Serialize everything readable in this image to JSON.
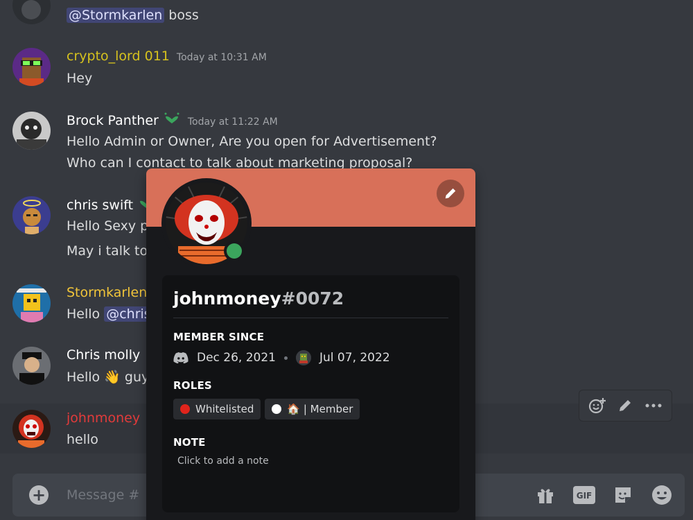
{
  "messages": [
    {
      "id": "m0",
      "username": "",
      "timestamp": "",
      "lines": [
        {
          "mention": "@Stormkarlen",
          "text": " boss"
        }
      ]
    },
    {
      "id": "m1",
      "username": "crypto_lord 011",
      "color": "#d6c21e",
      "timestamp": "Today at 10:31 AM",
      "lines": [
        "Hey"
      ]
    },
    {
      "id": "m2",
      "username": "Brock Panther",
      "color": "#ffffff",
      "timestamp": "Today at 11:22 AM",
      "lines": [
        "Hello Admin or Owner, Are you open for Advertisement?",
        "Who can I contact to talk about marketing proposal?"
      ]
    },
    {
      "id": "m3",
      "username": "chris swift",
      "color": "#ffffff",
      "lines": [
        "Hello Sexy p",
        "May i talk to"
      ]
    },
    {
      "id": "m4",
      "username": "Stormkarlen",
      "color": "#f0c43a",
      "lines": [
        {
          "text": "Hello ",
          "mention": "@chris"
        }
      ]
    },
    {
      "id": "m5",
      "username": "Chris molly",
      "color": "#ffffff",
      "lines": [
        {
          "text": "Hello ",
          "emoji": "👋",
          "tail": " guy"
        }
      ]
    },
    {
      "id": "m6",
      "username": "johnmoney",
      "color": "#e23b3b",
      "lines": [
        "hello"
      ]
    }
  ],
  "composer": {
    "placeholder": "Message #"
  },
  "profile": {
    "username": "johnmoney",
    "discriminator": "#0072",
    "banner_color": "#d87059",
    "status": "online",
    "member_since_title": "MEMBER SINCE",
    "discord_joined": "Dec 26, 2021",
    "server_joined": "Jul 07, 2022",
    "roles_title": "ROLES",
    "roles": [
      {
        "name": "Whitelisted",
        "color": "#e0241c"
      },
      {
        "name": "🏠 | Member",
        "color": "#ffffff"
      }
    ],
    "note_title": "NOTE",
    "note_placeholder": "Click to add a note"
  },
  "icons": {
    "edit": "pencil-icon",
    "add_reaction": "add-reaction-icon",
    "more": "more-options-icon",
    "gift": "gift-icon",
    "gif": "gif-icon",
    "sticker": "sticker-icon",
    "emoji": "emoji-icon",
    "attach": "plus-circle-icon"
  },
  "gif_label": "GIF"
}
